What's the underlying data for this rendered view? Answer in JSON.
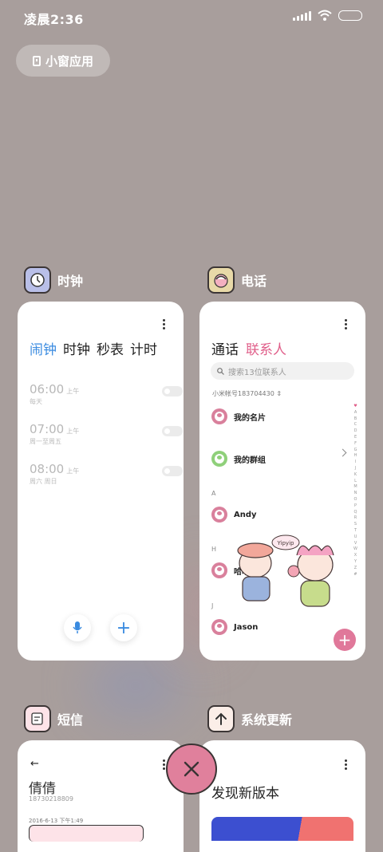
{
  "status_bar": {
    "time": "凌晨2:36",
    "signal": "signal-icon",
    "wifi": "wifi-icon",
    "battery": "battery-icon"
  },
  "floating_window_button": {
    "label": "小窗应用",
    "icon": "floating-window-icon"
  },
  "clock_app": {
    "name": "时钟",
    "icon": "clock-icon",
    "tabs": [
      {
        "label": "闹钟",
        "active": true
      },
      {
        "label": "时钟"
      },
      {
        "label": "秒表"
      },
      {
        "label": "计时"
      }
    ],
    "alarms": [
      {
        "time": "06:00",
        "ampm": "上午",
        "repeat": "每天",
        "enabled": false
      },
      {
        "time": "07:00",
        "ampm": "上午",
        "repeat": "周一至周五",
        "enabled": false
      },
      {
        "time": "08:00",
        "ampm": "上午",
        "repeat": "周六 周日",
        "enabled": false
      }
    ],
    "mic_icon": "microphone-icon",
    "add_label": "+"
  },
  "phone_app": {
    "name": "电话",
    "icon": "phone-app-icon",
    "tabs": [
      {
        "label": "通话"
      },
      {
        "label": "联系人",
        "active": true
      }
    ],
    "search_placeholder": "搜索13位联系人",
    "account": "小米帐号183704430",
    "rows": [
      {
        "label": "我的名片"
      },
      {
        "label": "我的群组"
      }
    ],
    "sections": [
      {
        "letter": "A",
        "name": "Andy"
      },
      {
        "letter": "H",
        "name": "哈哈"
      },
      {
        "letter": "J",
        "name": "Jason"
      }
    ],
    "alphabet": [
      "♥",
      "A",
      "B",
      "C",
      "D",
      "E",
      "F",
      "G",
      "H",
      "I",
      "J",
      "K",
      "L",
      "M",
      "N",
      "O",
      "P",
      "Q",
      "R",
      "S",
      "T",
      "U",
      "V",
      "W",
      "X",
      "Y",
      "Z",
      "#"
    ],
    "sticker_text": "Yipyip",
    "fab_label": "+"
  },
  "sms_app": {
    "name": "短信",
    "icon": "message-icon",
    "back": "←",
    "contact": "倩倩",
    "number": "18730218809",
    "date": "2016-6-13 下午1:49"
  },
  "update_app": {
    "name": "系统更新",
    "icon": "update-arrow-icon",
    "title": "发现新版本"
  },
  "close_all": {
    "icon": "close-icon"
  },
  "colors": {
    "background": "#a89e9c",
    "clock_accent": "#3a8be0",
    "phone_accent": "#e05f8a",
    "close": "#e0809c"
  }
}
